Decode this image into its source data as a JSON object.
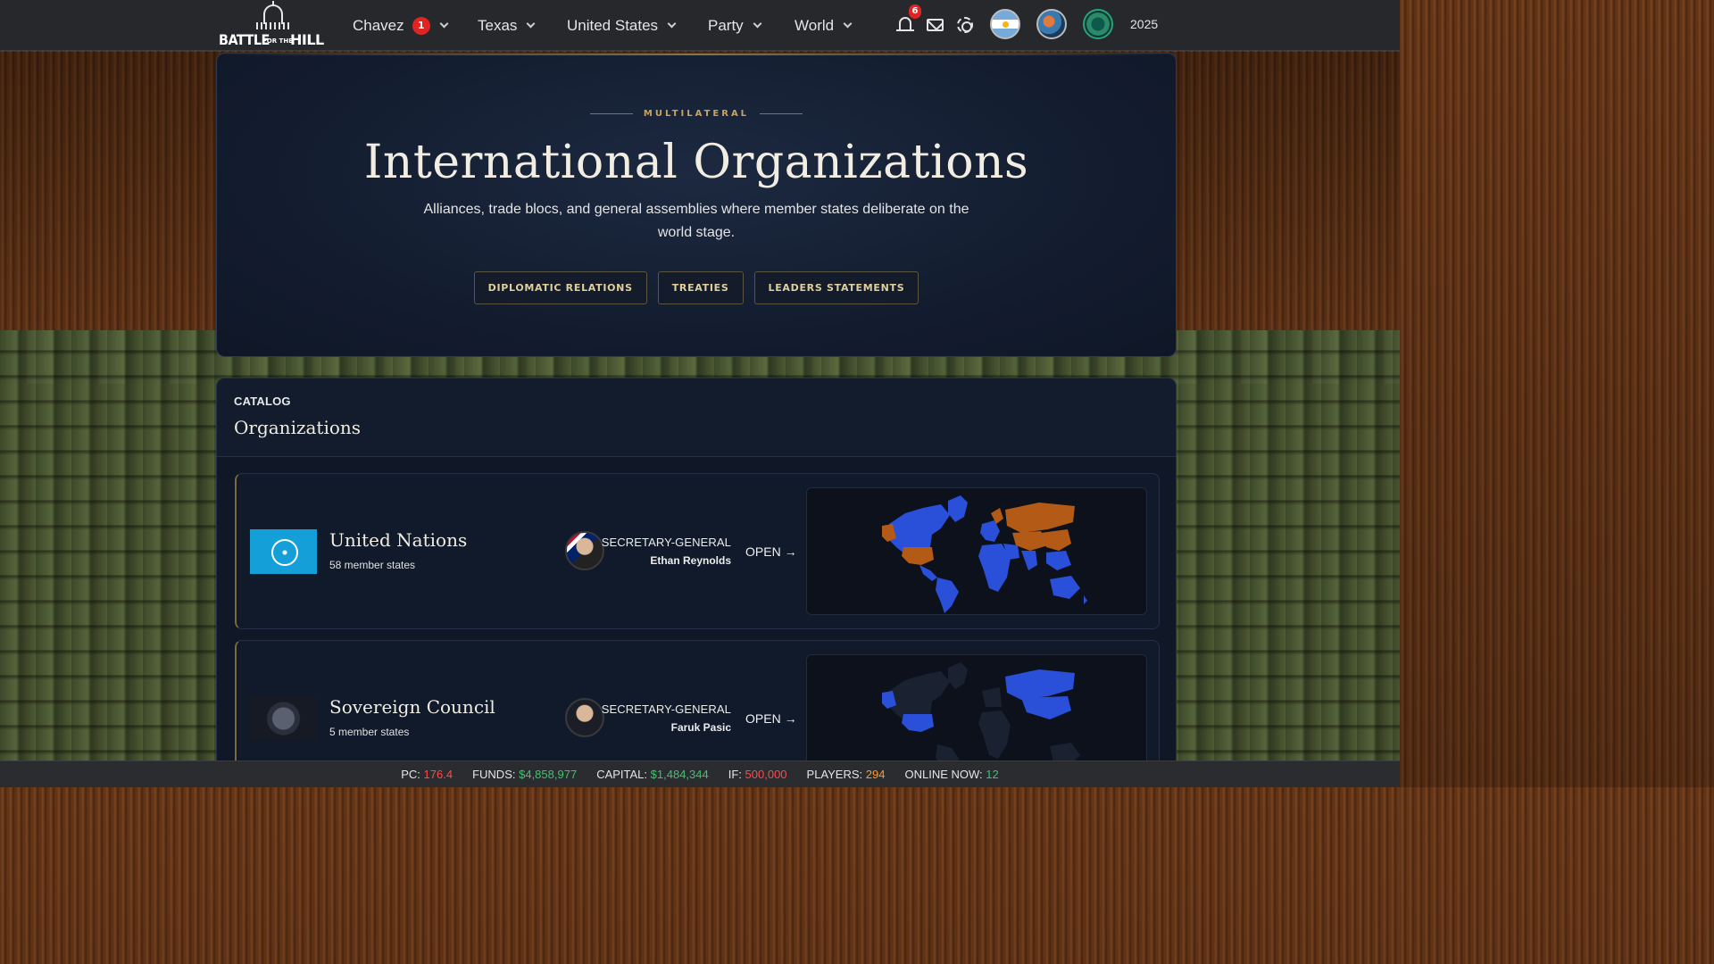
{
  "header": {
    "logo": {
      "line1": "BATTLE",
      "line2": "FOR THE",
      "line3": "HILL"
    },
    "nav": [
      {
        "label": "Chavez",
        "badge": "1"
      },
      {
        "label": "Texas"
      },
      {
        "label": "United States"
      },
      {
        "label": "Party"
      },
      {
        "label": "World"
      }
    ],
    "notifications_count": "6",
    "year": "2025",
    "icons": [
      "bell-icon",
      "mail-icon",
      "gear-icon",
      "argentina-flag-avatar",
      "profile-avatar",
      "party-avatar"
    ]
  },
  "hero": {
    "kicker": "MULTILATERAL",
    "title": "International Organizations",
    "subtitle": "Alliances, trade blocs, and general assemblies where member states deliberate on the world stage.",
    "buttons": [
      "DIPLOMATIC RELATIONS",
      "TREATIES",
      "LEADERS STATEMENTS"
    ]
  },
  "catalog": {
    "kicker": "CATALOG",
    "title": "Organizations",
    "organizations": [
      {
        "name": "United Nations",
        "members": "58 member states",
        "role": "SECRETARY-GENERAL",
        "leader": "Ethan Reynolds",
        "open": "OPEN →"
      },
      {
        "name": "Sovereign Council",
        "members": "5 member states",
        "role": "SECRETARY-GENERAL",
        "leader": "Faruk Pasic",
        "open": "OPEN →"
      }
    ]
  },
  "map_colors": {
    "member": "#2a4fd8",
    "leader": "#b25a16",
    "nonmember": "#1a2232"
  },
  "status_bar": {
    "pc_label": "PC:",
    "pc_value": "176.4",
    "funds_label": "FUNDS:",
    "funds_value": "$4,858,977",
    "capital_label": "CAPITAL:",
    "capital_value": "$1,484,344",
    "if_label": "IF:",
    "if_value": "500,000",
    "players_label": "PLAYERS:",
    "players_value": "294",
    "online_label": "ONLINE NOW:",
    "online_value": "12"
  }
}
